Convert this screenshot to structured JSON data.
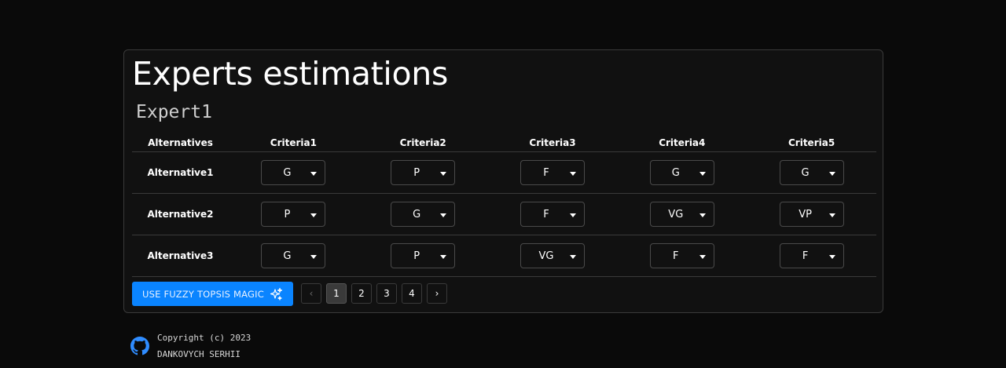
{
  "page": {
    "title": "Experts estimations"
  },
  "expert": {
    "name": "Expert1"
  },
  "table": {
    "headers": [
      "Alternatives",
      "Criteria1",
      "Criteria2",
      "Criteria3",
      "Criteria4",
      "Criteria5"
    ],
    "rows": [
      {
        "label": "Alternative1",
        "values": [
          "G",
          "P",
          "F",
          "G",
          "G"
        ]
      },
      {
        "label": "Alternative2",
        "values": [
          "P",
          "G",
          "F",
          "VG",
          "VP"
        ]
      },
      {
        "label": "Alternative3",
        "values": [
          "G",
          "P",
          "VG",
          "F",
          "F"
        ]
      }
    ]
  },
  "actions": {
    "magic_label": "USE FUZZY TOPSIS MAGIC"
  },
  "pagination": {
    "pages": [
      "1",
      "2",
      "3",
      "4"
    ],
    "current": "1",
    "prev": "‹",
    "next": "›"
  },
  "footer": {
    "copyright": "Copyright (c) 2023",
    "author": "DANKOVYCH SERHII"
  },
  "colors": {
    "accent": "#0a84ff",
    "background": "#0a0a0a",
    "card": "#111111",
    "border": "#3a3a3a"
  },
  "icons": {
    "magic": "sparkle-icon",
    "select": "chevron-down-icon",
    "footer": "github-icon"
  }
}
